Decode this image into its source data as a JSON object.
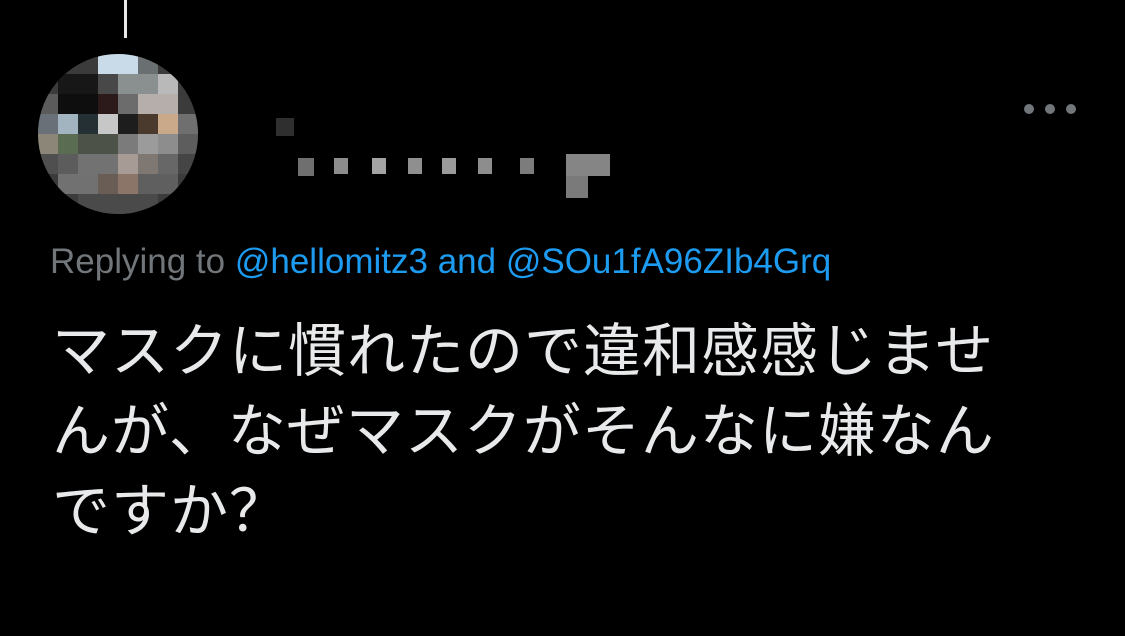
{
  "tweet": {
    "replying_prefix": "Replying to",
    "mention_1": "@hellomitz3",
    "conjunction": "and",
    "mention_2": "@SOu1fA96ZIb4Grq",
    "text_lines": [
      "マスクに慣れたので違和感感じませ",
      "んが、なぜマスクがそんなに嫌なん",
      "ですか？"
    ]
  },
  "icons": {
    "more": "more-horizontal-icon"
  },
  "colors": {
    "background": "#000000",
    "text": "#e7e9ea",
    "muted": "#71767b",
    "link": "#1d9bf0"
  }
}
